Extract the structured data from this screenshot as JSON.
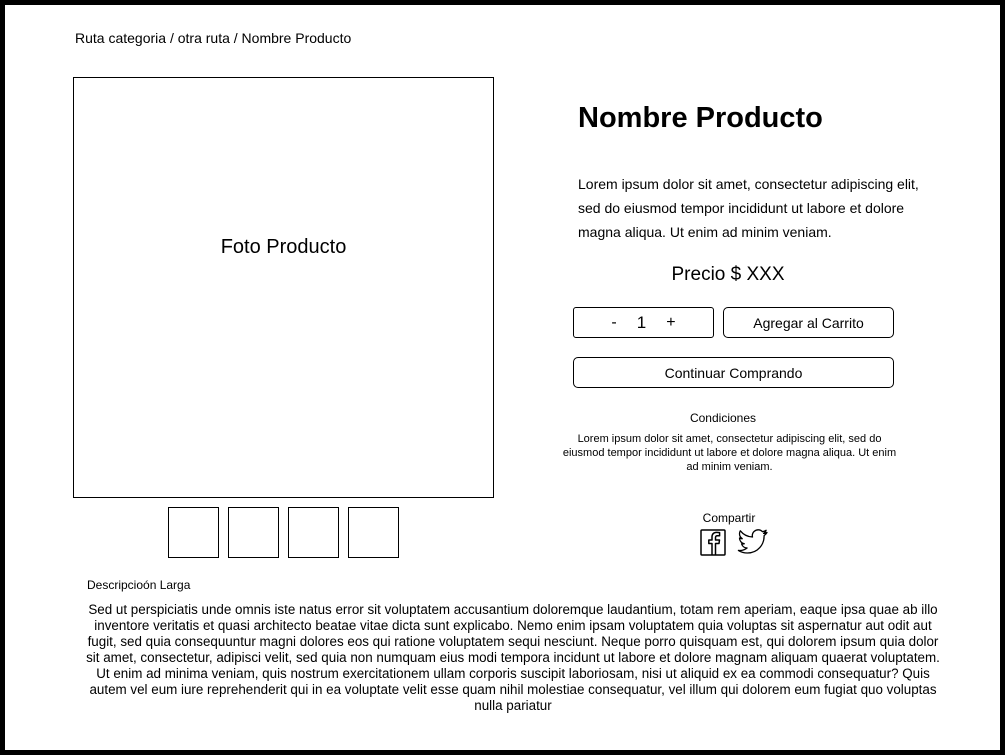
{
  "breadcrumb": {
    "items": [
      "Ruta categoria",
      "otra ruta",
      "Nombre Producto"
    ],
    "separator": " / "
  },
  "gallery": {
    "main_photo_label": "Foto Producto",
    "thumbnail_count": 4
  },
  "product": {
    "name": "Nombre Producto",
    "description": "Lorem ipsum dolor sit amet, consectetur adipiscing elit, sed do eiusmod tempor incididunt ut labore et dolore magna aliqua. Ut enim ad minim veniam.",
    "price": "Precio $ XXX"
  },
  "quantity": {
    "minus": "-",
    "value": "1",
    "plus": "+"
  },
  "buttons": {
    "add_to_cart": "Agregar al Carrito",
    "continue_shopping": "Continuar Comprando"
  },
  "conditions": {
    "title": "Condiciones",
    "text": "Lorem ipsum dolor sit amet, consectetur adipiscing elit, sed do eiusmod tempor incididunt ut labore et dolore magna aliqua. Ut enim ad minim veniam."
  },
  "share": {
    "title": "Compartir",
    "icons": [
      "facebook-icon",
      "twitter-icon"
    ]
  },
  "long_description": {
    "title": "Descripcioón Larga",
    "text": "Sed ut perspiciatis unde omnis iste natus error sit voluptatem accusantium doloremque laudantium, totam rem aperiam, eaque ipsa quae ab illo inventore veritatis et quasi architecto beatae vitae dicta sunt explicabo. Nemo enim ipsam voluptatem quia voluptas sit aspernatur aut odit aut fugit, sed quia consequuntur magni dolores eos qui ratione voluptatem sequi nesciunt. Neque porro quisquam est, qui dolorem ipsum quia dolor sit amet, consectetur, adipisci velit, sed quia non numquam eius modi tempora incidunt ut labore et dolore magnam aliquam quaerat voluptatem. Ut enim ad minima veniam, quis nostrum exercitationem ullam corporis suscipit laboriosam, nisi ut aliquid ex ea commodi consequatur? Quis autem vel eum iure reprehenderit qui in ea voluptate velit esse quam nihil molestiae consequatur, vel illum qui dolorem eum fugiat quo voluptas nulla pariatur"
  },
  "colors": {
    "border": "#000000",
    "background": "#ffffff",
    "text": "#000000"
  }
}
